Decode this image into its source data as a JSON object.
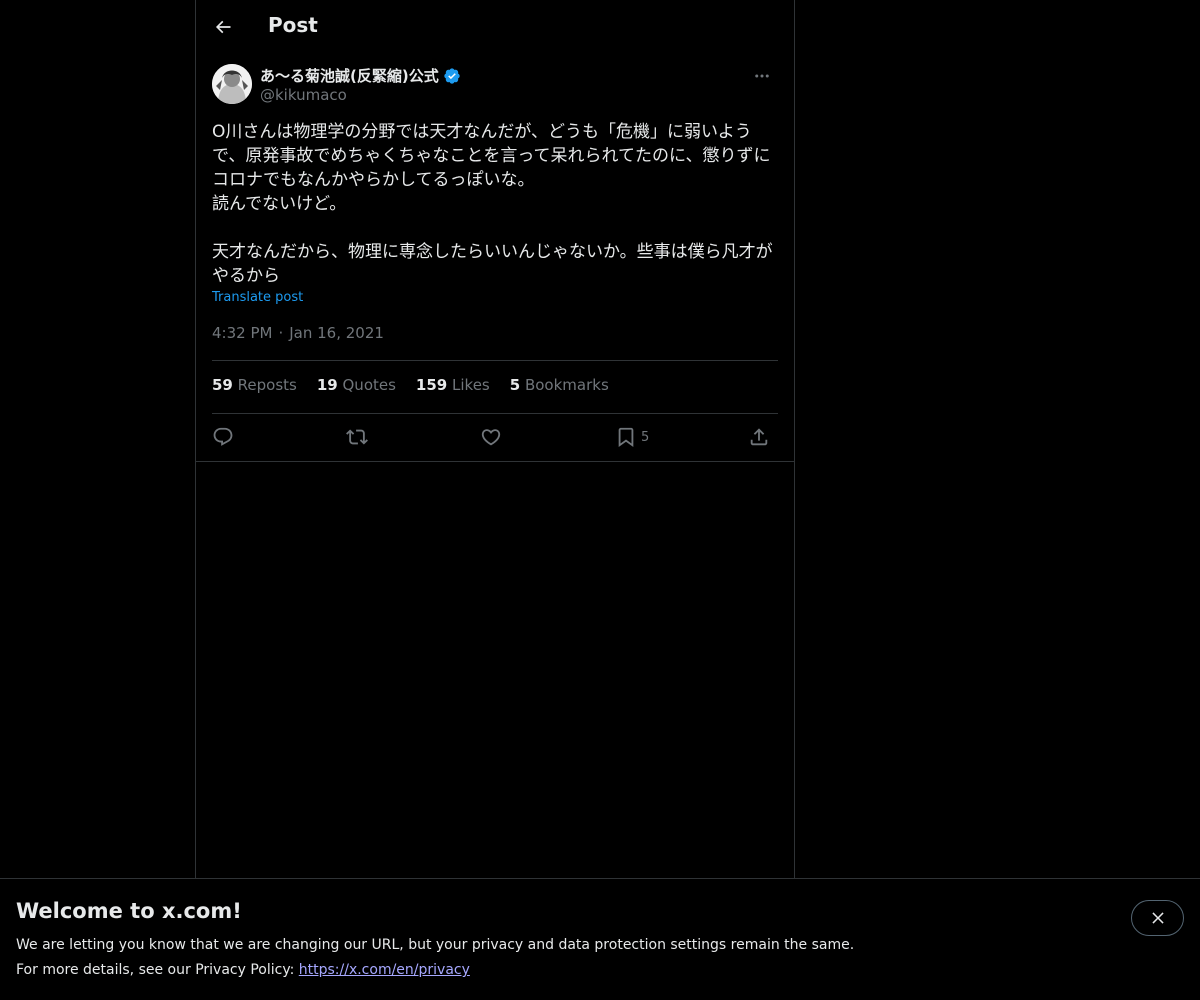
{
  "header": {
    "title": "Post"
  },
  "author": {
    "name": "あ〜る菊池誠(反緊縮)公式",
    "handle": "@kikumaco",
    "verified": true
  },
  "post": {
    "lines": [
      "O川さんは物理学の分野では天才なんだが、どうも「危機」に弱いよう",
      "で、原発事故でめちゃくちゃなことを言って呆れられてたのに、懲りずに",
      "コロナでもなんかやらかしてるっぽいな。",
      "読んでないけど。",
      "",
      "天才なんだから、物理に専念したらいいんじゃないか。些事は僕ら凡才が",
      "やるから"
    ],
    "translate_label": "Translate post",
    "time": "4:32 PM",
    "separator": "·",
    "date": "Jan 16, 2021"
  },
  "stats": {
    "reposts": {
      "count": "59",
      "label": "Reposts"
    },
    "quotes": {
      "count": "19",
      "label": "Quotes"
    },
    "likes": {
      "count": "159",
      "label": "Likes"
    },
    "bookmarks": {
      "count": "5",
      "label": "Bookmarks"
    }
  },
  "actions": {
    "bookmark_count": "5"
  },
  "banner": {
    "title": "Welcome to x.com!",
    "line1": "We are letting you know that we are changing our URL, but your privacy and data protection settings remain the same.",
    "line2_prefix": "For more details, see our Privacy Policy: ",
    "link": "https://x.com/en/privacy"
  },
  "colors": {
    "background": "#000000",
    "text": "#e7e9ea",
    "muted": "#71767b",
    "accent": "#1d9bf0",
    "border": "#2f3336"
  },
  "icons": {
    "back": "arrow-left-icon",
    "verified": "verified-badge-icon",
    "more": "more-horizontal-icon",
    "reply": "reply-icon",
    "repost": "repost-icon",
    "like": "heart-icon",
    "bookmark": "bookmark-icon",
    "share": "share-icon",
    "close": "close-icon"
  }
}
